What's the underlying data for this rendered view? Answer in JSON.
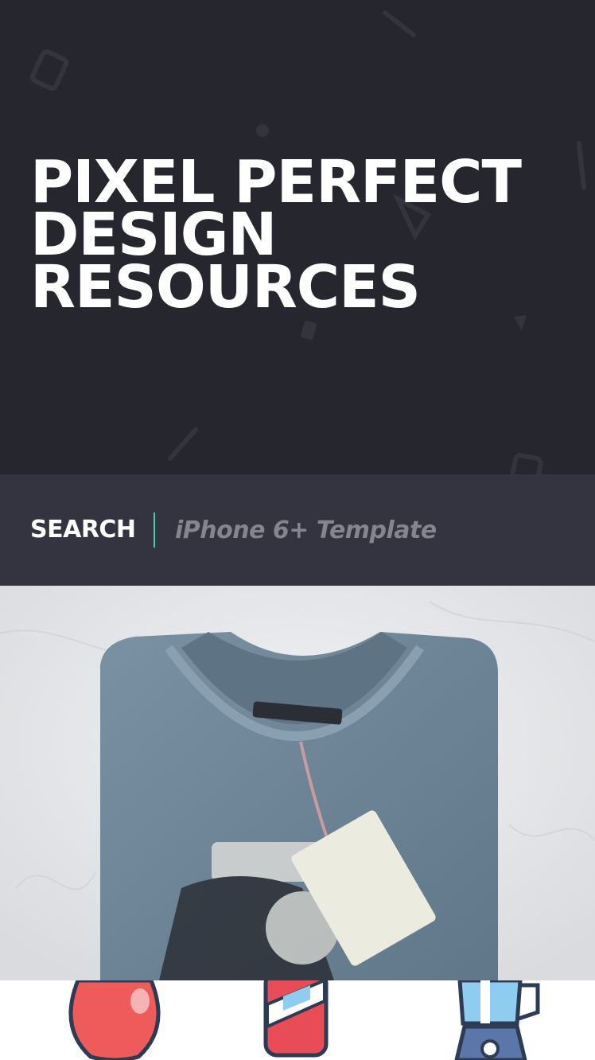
{
  "hero": {
    "title_lines": [
      "PIXEL PERFECT",
      "DESIGN",
      "RESOURCES"
    ]
  },
  "search": {
    "label": "SEARCH",
    "placeholder": "iPhone 6+ Template",
    "accent_color": "#3fd0b0"
  },
  "feature": {
    "image_description_icon": "folded-tshirt-mockup",
    "shirt_color": "#6d8598"
  },
  "icons": [
    {
      "name": "apple-icon"
    },
    {
      "name": "drink-can-icon"
    },
    {
      "name": "blender-icon"
    }
  ],
  "colors": {
    "hero_bg": "#25262e",
    "search_bg": "#33343f"
  }
}
